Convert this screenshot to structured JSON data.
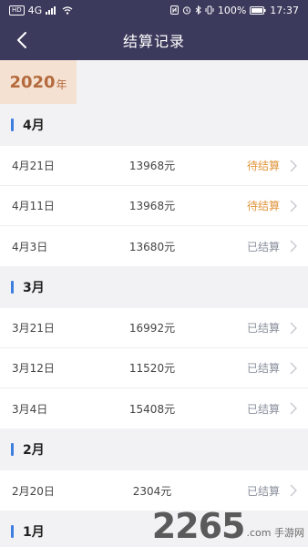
{
  "statusbar": {
    "left_badge": "HD",
    "signal": "4G",
    "battery": "100%",
    "time": "17:37"
  },
  "nav": {
    "title": "结算记录"
  },
  "year": {
    "value": "2020",
    "unit": "年"
  },
  "months": [
    {
      "label": "4月",
      "rows": [
        {
          "date": "4月21日",
          "amount": "13968元",
          "status": "待结算",
          "state": "pending"
        },
        {
          "date": "4月11日",
          "amount": "13968元",
          "status": "待结算",
          "state": "pending"
        },
        {
          "date": "4月3日",
          "amount": "13680元",
          "status": "已结算",
          "state": "done"
        }
      ]
    },
    {
      "label": "3月",
      "rows": [
        {
          "date": "3月21日",
          "amount": "16992元",
          "status": "已结算",
          "state": "done"
        },
        {
          "date": "3月12日",
          "amount": "11520元",
          "status": "已结算",
          "state": "done"
        },
        {
          "date": "3月4日",
          "amount": "15408元",
          "status": "已结算",
          "state": "done"
        }
      ]
    },
    {
      "label": "2月",
      "rows": [
        {
          "date": "2月20日",
          "amount": "2304元",
          "status": "已结算",
          "state": "done"
        }
      ]
    },
    {
      "label": "1月",
      "rows": []
    }
  ],
  "watermark": {
    "main": "2265",
    "sub": ".com 手游网"
  },
  "colors": {
    "header": "#3b3a5c",
    "accent": "#3d7fe0",
    "pending": "#e0963c",
    "done": "#8a8f9c",
    "year_bg": "#f4e1d2",
    "year_text": "#b46a3c"
  }
}
